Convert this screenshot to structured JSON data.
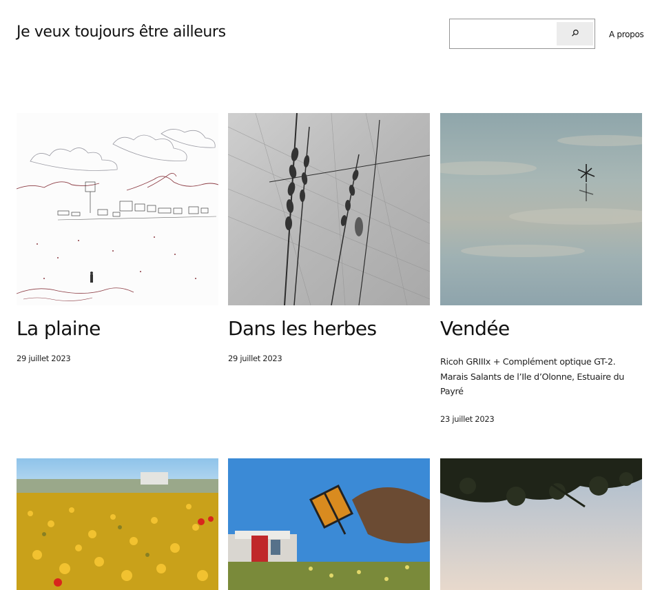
{
  "header": {
    "site_title": "Je veux toujours être ailleurs",
    "search": {
      "value": "",
      "placeholder": ""
    },
    "nav": {
      "about_label": "A propos"
    }
  },
  "icons": {
    "search_button": "search-icon"
  },
  "posts": [
    {
      "title": "La plaine",
      "date": "29 juillet 2023",
      "excerpt": ""
    },
    {
      "title": "Dans les herbes",
      "date": "29 juillet 2023",
      "excerpt": ""
    },
    {
      "title": "Vendée",
      "date": "23 juillet 2023",
      "excerpt": "Ricoh GRIIIx + Complément optique GT-2. Marais Salants de l’Ile d’Olonne, Estuaire du Payré"
    }
  ],
  "colors": {
    "text": "#111111",
    "search_border": "#949494",
    "search_button_bg": "#ececec"
  }
}
